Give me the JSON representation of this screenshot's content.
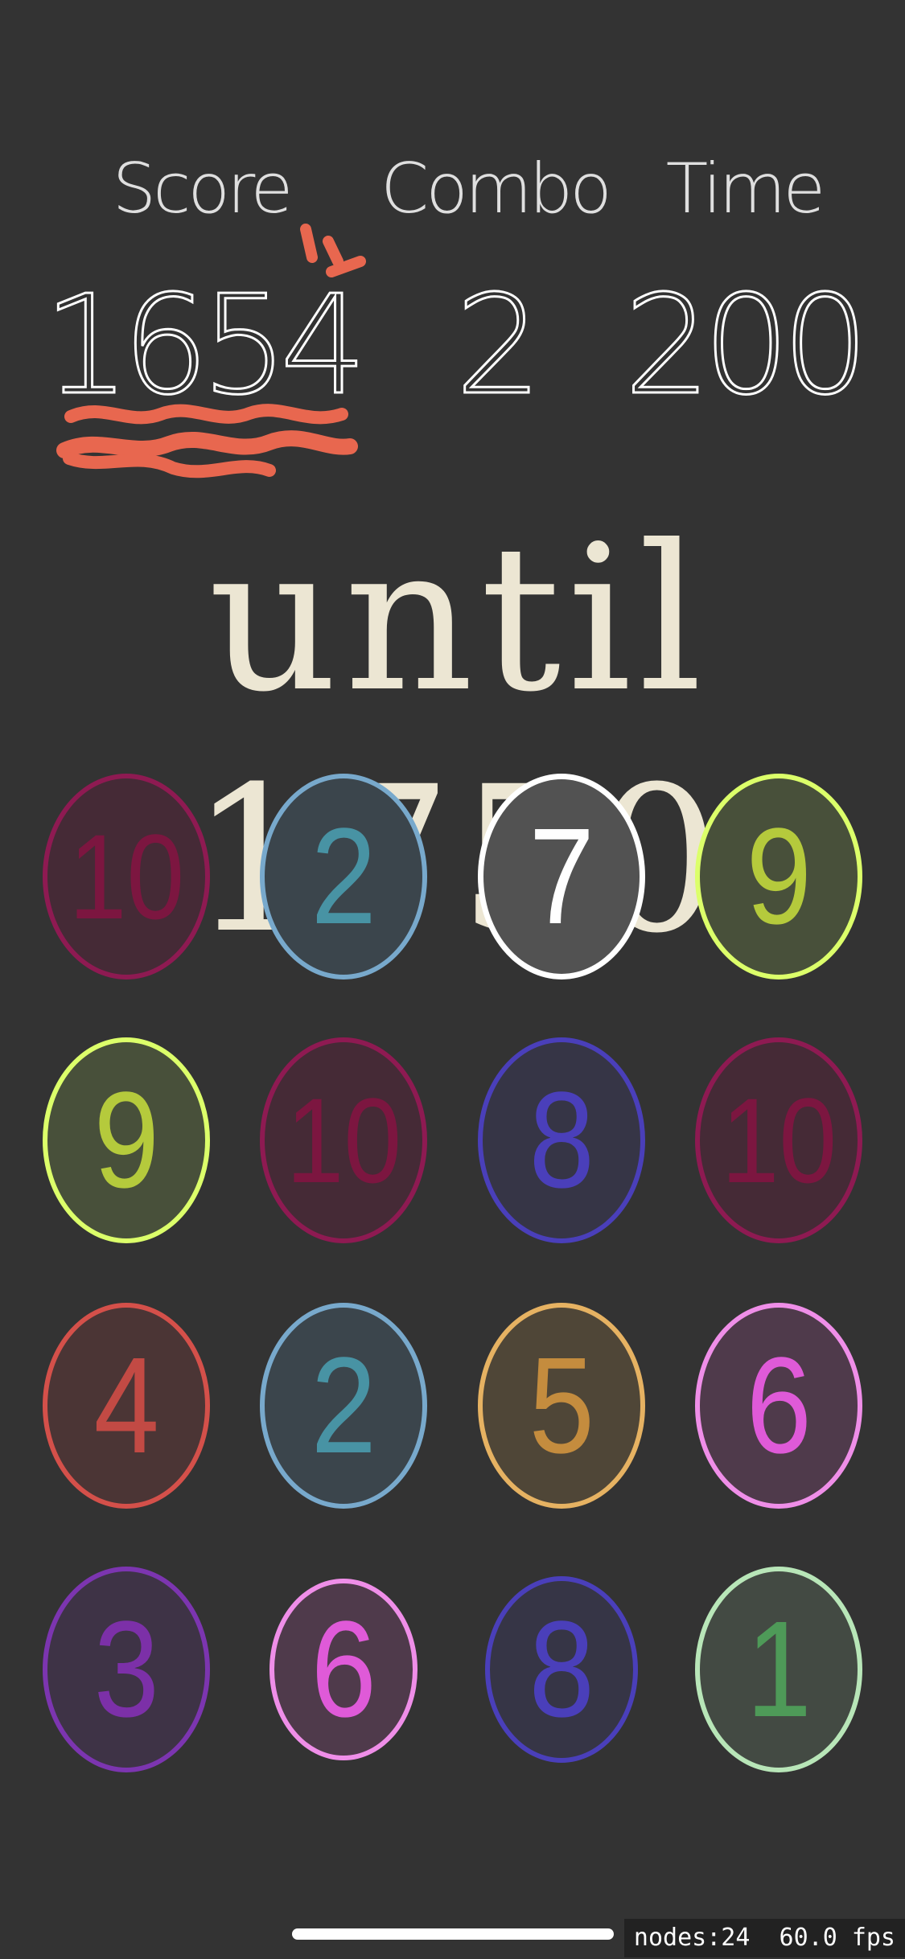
{
  "hud": {
    "score_label": "Score",
    "combo_label": "Combo",
    "time_label": "Time",
    "score": "1654",
    "combo": "2",
    "time": "200"
  },
  "target_text": "until 1750",
  "debug": {
    "nodes": "nodes:24",
    "fps": "60.0 fps",
    "line": "nodes:24  60.0 fps"
  },
  "colors": {
    "background": "#333333",
    "accent_squiggle": "#e8674f",
    "handwriting": "#ece6d3"
  },
  "tiles": [
    {
      "value": "10",
      "ring": "#8e1a52",
      "fill": "#452a36",
      "text": "#7c1640",
      "selected": false
    },
    {
      "value": "2",
      "ring": "#78a9cc",
      "fill": "#3b454c",
      "text": "#4893a4",
      "selected": false
    },
    {
      "value": "7",
      "ring": "#ffffff",
      "fill": "#525252",
      "text": "#ffffff",
      "selected": true
    },
    {
      "value": "9",
      "ring": "#dcff6a",
      "fill": "#48503a",
      "text": "#b5ca3c",
      "selected": false
    },
    {
      "value": "9",
      "ring": "#dcff6a",
      "fill": "#48503a",
      "text": "#b5ca3c",
      "selected": false
    },
    {
      "value": "10",
      "ring": "#8e1a52",
      "fill": "#452a36",
      "text": "#7c1640",
      "selected": false
    },
    {
      "value": "8",
      "ring": "#4a3fba",
      "fill": "#363546",
      "text": "#4a3fba",
      "selected": false
    },
    {
      "value": "10",
      "ring": "#8e1a52",
      "fill": "#452a36",
      "text": "#7c1640",
      "selected": false
    },
    {
      "value": "4",
      "ring": "#d4504a",
      "fill": "#4b3535",
      "text": "#c24a44",
      "selected": false
    },
    {
      "value": "2",
      "ring": "#78a9cc",
      "fill": "#3b454c",
      "text": "#4893a4",
      "selected": false
    },
    {
      "value": "5",
      "ring": "#e6b262",
      "fill": "#4f4637",
      "text": "#c48c3e",
      "selected": false
    },
    {
      "value": "6",
      "ring": "#ef8ee8",
      "fill": "#4f3a4b",
      "text": "#df5ad8",
      "selected": false
    },
    {
      "value": "3",
      "ring": "#7c35b0",
      "fill": "#3e3346",
      "text": "#7c30a8",
      "selected": false
    },
    {
      "value": "6",
      "ring": "#ef8ee8",
      "fill": "#4f3a4b",
      "text": "#df5ad8",
      "selected": false
    },
    {
      "value": "8",
      "ring": "#4a3fba",
      "fill": "#363546",
      "text": "#4a3fba",
      "selected": false
    },
    {
      "value": "1",
      "ring": "#b8e6b8",
      "fill": "#434a43",
      "text": "#4e9a58",
      "selected": false
    }
  ]
}
